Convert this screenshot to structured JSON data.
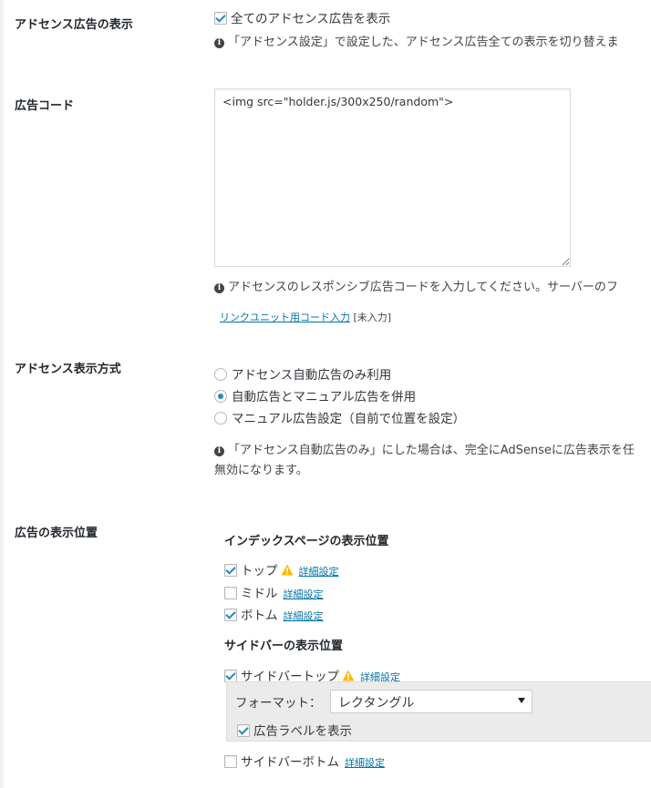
{
  "adsense_display": {
    "label": "アドセンス広告の表示",
    "checkbox_label": "全てのアドセンス広告を表示",
    "checked": true,
    "description": "「アドセンス設定」で設定した、アドセンス広告全ての表示を切り替えま"
  },
  "ad_code": {
    "label": "広告コード",
    "value": "<img src=\"holder.js/300x250/random\">",
    "description": "アドセンスのレスポンシブ広告コードを入力してください。サーバーのフ",
    "link_unit_link": "リンクユニット用コード入力",
    "link_unit_status": "[未入力]"
  },
  "display_method": {
    "label": "アドセンス表示方式",
    "options": [
      {
        "label": "アドセンス自動広告のみ利用",
        "checked": false
      },
      {
        "label": "自動広告とマニュアル広告を併用",
        "checked": true
      },
      {
        "label": "マニュアル広告設定（自前で位置を設定）",
        "checked": false
      }
    ],
    "description_line1": "「アドセンス自動広告のみ」にした場合は、完全にAdSenseに広告表示を任",
    "description_line2": "無効になります。"
  },
  "positions": {
    "label": "広告の表示位置",
    "index_heading": "インデックスページの表示位置",
    "index_items": [
      {
        "label": "トップ",
        "checked": true,
        "warning": true,
        "link": "詳細設定"
      },
      {
        "label": "ミドル",
        "checked": false,
        "warning": false,
        "link": "詳細設定"
      },
      {
        "label": "ボトム",
        "checked": true,
        "warning": false,
        "link": "詳細設定"
      }
    ],
    "sidebar_heading": "サイドバーの表示位置",
    "sidebar_top": {
      "label": "サイドバートップ",
      "checked": true,
      "warning": true,
      "link": "詳細設定"
    },
    "format_label": "フォーマット：",
    "format_value": "レクタングル",
    "ad_label_checkbox": "広告ラベルを表示",
    "ad_label_checked": true,
    "sidebar_bottom": {
      "label": "サイドバーボトム",
      "checked": false,
      "link": "詳細設定"
    }
  },
  "colors": {
    "accent": "#1e8cbe",
    "link": "#0073aa",
    "warning": "#ffb900"
  }
}
